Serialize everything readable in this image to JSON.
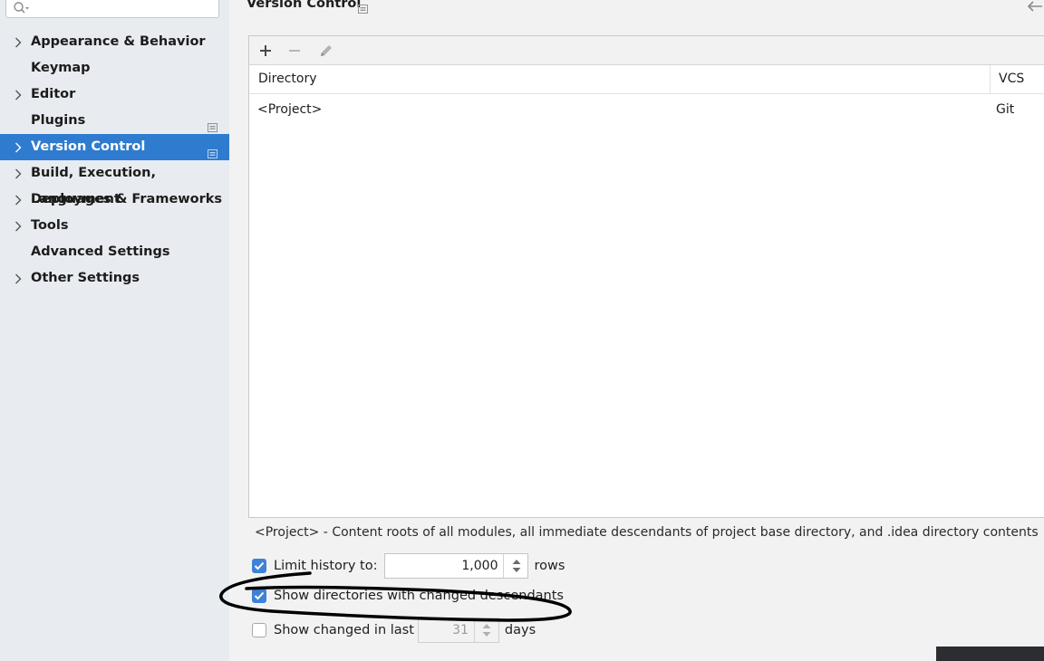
{
  "search": {
    "placeholder": ""
  },
  "sidebar": {
    "items": [
      {
        "label": "Appearance & Behavior",
        "expandable": true,
        "project_scope": false,
        "selected": false
      },
      {
        "label": "Keymap",
        "expandable": false,
        "project_scope": false,
        "selected": false
      },
      {
        "label": "Editor",
        "expandable": true,
        "project_scope": false,
        "selected": false
      },
      {
        "label": "Plugins",
        "expandable": false,
        "project_scope": true,
        "selected": false
      },
      {
        "label": "Version Control",
        "expandable": true,
        "project_scope": true,
        "selected": true
      },
      {
        "label": "Build, Execution, Deployment",
        "expandable": true,
        "project_scope": false,
        "selected": false
      },
      {
        "label": "Languages & Frameworks",
        "expandable": true,
        "project_scope": false,
        "selected": false
      },
      {
        "label": "Tools",
        "expandable": true,
        "project_scope": false,
        "selected": false
      },
      {
        "label": "Advanced Settings",
        "expandable": false,
        "project_scope": false,
        "selected": false
      },
      {
        "label": "Other Settings",
        "expandable": true,
        "project_scope": false,
        "selected": false
      }
    ]
  },
  "main": {
    "title": "Version Control",
    "toolbar": {
      "icons": [
        "add-icon",
        "remove-icon",
        "edit-icon"
      ]
    },
    "table": {
      "columns": [
        "Directory",
        "VCS"
      ],
      "rows": [
        {
          "directory": "<Project>",
          "vcs": "Git"
        }
      ]
    },
    "description": "<Project> - Content roots of all modules, all immediate descendants of project base directory, and .idea directory contents",
    "options": {
      "limit_history": {
        "label": "Limit history to:",
        "checked": true,
        "value": "1,000",
        "suffix": "rows"
      },
      "show_dirs": {
        "label": "Show directories with changed descendants",
        "checked": true
      },
      "show_changed": {
        "label": "Show changed in last",
        "checked": false,
        "value": "31",
        "suffix": "days"
      }
    }
  },
  "colors": {
    "selected": "#2f7bcf",
    "checkbox": "#3d82d6",
    "sidebar_bg": "#e8ebef",
    "main_bg": "#f2f2f2"
  }
}
